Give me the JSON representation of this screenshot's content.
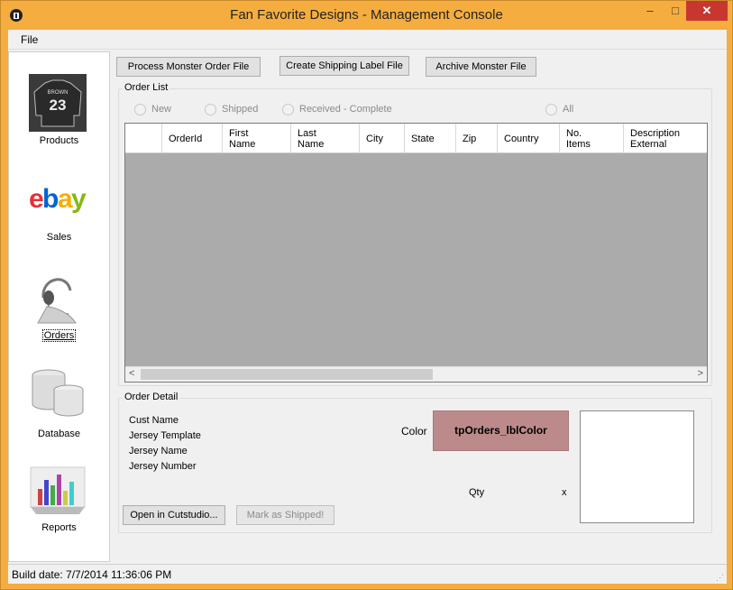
{
  "window": {
    "title": "Fan Favorite Designs - Management Console",
    "minimize_glyph": "–",
    "maximize_glyph": "□",
    "close_glyph": "✕"
  },
  "menu": {
    "file_label": "File"
  },
  "nav": {
    "items": [
      {
        "label": "Products",
        "icon": "jersey-icon"
      },
      {
        "label": "Sales",
        "icon": "ebay-logo-icon"
      },
      {
        "label": "Orders",
        "icon": "headset-icon",
        "selected": true
      },
      {
        "label": "Database",
        "icon": "database-icon"
      },
      {
        "label": "Reports",
        "icon": "bar-chart-icon"
      }
    ],
    "jersey_text": {
      "name": "BROWN",
      "number": "23"
    }
  },
  "toolbar": {
    "process_label": "Process Monster Order File",
    "shipping_label": "Create Shipping Label File",
    "archive_label": "Archive Monster File"
  },
  "order_list": {
    "title": "Order List",
    "filters": [
      "New",
      "Shipped",
      "Received - Complete",
      "All"
    ],
    "columns": [
      "OrderId",
      "First\nName",
      "Last\nName",
      "City",
      "State",
      "Zip",
      "Country",
      "No.\nItems",
      "Description\nExternal"
    ],
    "scroll_left": "<",
    "scroll_right": ">"
  },
  "order_detail": {
    "title": "Order Detail",
    "fields": [
      "Cust Name",
      "Jersey Template",
      "Jersey Name",
      "Jersey Number"
    ],
    "color_label": "Color",
    "color_value": "tpOrders_lblColor",
    "color_hex": "#bc8a8a",
    "qty_label": "Qty",
    "x_label": "x",
    "open_button": "Open in Cutstudio...",
    "ship_button": "Mark as Shipped!"
  },
  "status": {
    "build_date": "Build date: 7/7/2014 11:36:06 PM"
  },
  "colors": {
    "title_bar": "#f5ad3f",
    "close_button": "#c7372f",
    "grid_bg": "#ababab"
  }
}
